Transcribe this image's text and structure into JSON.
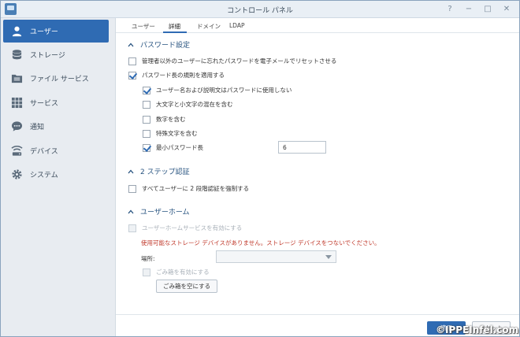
{
  "window": {
    "title": "コントロール パネル"
  },
  "sidebar": {
    "items": [
      {
        "label": "ユーザー",
        "icon": "user-icon"
      },
      {
        "label": "ストレージ",
        "icon": "database-icon"
      },
      {
        "label": "ファイル サービス",
        "icon": "folder-icon"
      },
      {
        "label": "サービス",
        "icon": "grid-icon"
      },
      {
        "label": "通知",
        "icon": "chat-icon"
      },
      {
        "label": "デバイス",
        "icon": "signal-icon"
      },
      {
        "label": "システム",
        "icon": "gear-icon"
      }
    ]
  },
  "tabs": [
    "ユーザー",
    "詳細",
    "ドメイン",
    "LDAP"
  ],
  "password": {
    "heading": "パスワード設定",
    "reset_by_email": "管理者以外のユーザーに忘れたパスワードを電子メールでリセットさせる",
    "apply_rules": "パスワード長の規則を適用する",
    "rules": [
      {
        "label": "ユーザー名および説明文はパスワードに使用しない",
        "checked": true
      },
      {
        "label": "大文字と小文字の混在を含む",
        "checked": false
      },
      {
        "label": "数字を含む",
        "checked": false
      },
      {
        "label": "特殊文字を含む",
        "checked": false
      },
      {
        "label": "最小パスワード長",
        "checked": true
      }
    ],
    "min_length_value": "6"
  },
  "two_step": {
    "heading": "2 ステップ認証",
    "enforce_all": "すべてユーザーに 2 段階認証を強制する"
  },
  "home": {
    "heading": "ユーザーホーム",
    "enable_service": "ユーザーホームサービスを有効にする",
    "warning": "使用可能なストレージ デバイスがありません。ストレージ デバイスをつないでください。",
    "location_label": "場所:",
    "enable_recycle": "ごみ箱を有効にする",
    "empty_recycle": "ごみ箱を空にする"
  },
  "footer": {
    "apply": "適用",
    "reset": "リセット"
  },
  "watermark": "©IPPEInfel.com",
  "colors": {
    "accent": "#2f6bb3",
    "warning": "#c0392b",
    "heading": "#26527f"
  }
}
